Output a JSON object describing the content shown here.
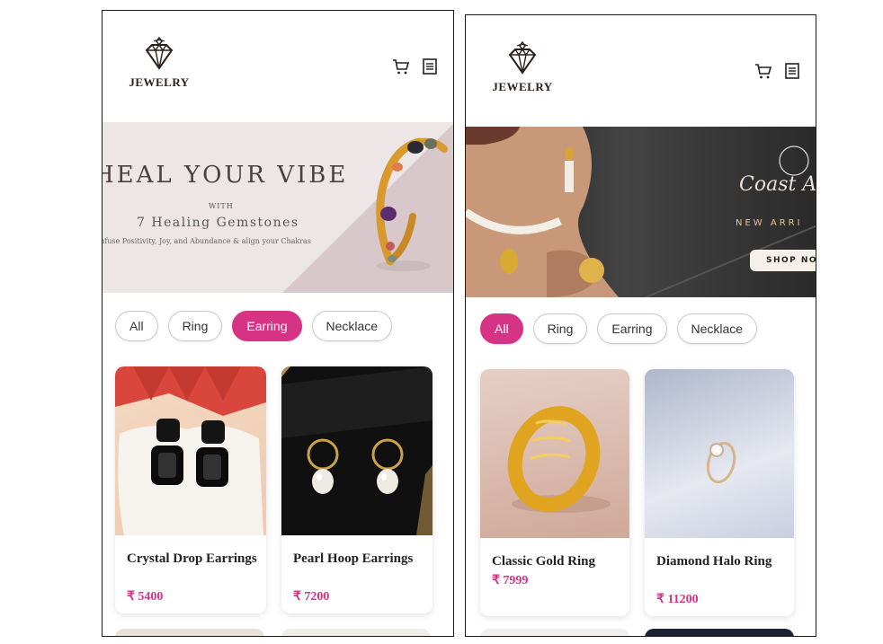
{
  "screens": [
    {
      "header": {
        "logo_text": "JEWELRY",
        "cart_icon": "cart-icon",
        "menu_icon": "menu-icon"
      },
      "banner": {
        "title": "HEAL YOUR VIBE",
        "with": "WITH",
        "subtitle": "7 Healing Gemstones",
        "tagline": "Infuse Positivity, Joy, and Abundance & align your Chakras"
      },
      "filters": [
        {
          "label": "All",
          "active": false
        },
        {
          "label": "Ring",
          "active": false
        },
        {
          "label": "Earring",
          "active": true
        },
        {
          "label": "Necklace",
          "active": false
        }
      ],
      "products": [
        {
          "name": "Crystal Drop Earrings",
          "price": "₹ 5400"
        },
        {
          "name": "Pearl Hoop Earrings",
          "price": "₹ 7200"
        }
      ]
    },
    {
      "header": {
        "logo_text": "JEWELRY",
        "cart_icon": "cart-icon",
        "menu_icon": "menu-icon"
      },
      "banner": {
        "script_title": "Coast A",
        "new_arrivals": "NEW ARRI",
        "shop_button": "SHOP NO"
      },
      "filters": [
        {
          "label": "All",
          "active": true
        },
        {
          "label": "Ring",
          "active": false
        },
        {
          "label": "Earring",
          "active": false
        },
        {
          "label": "Necklace",
          "active": false
        }
      ],
      "products": [
        {
          "name": "Classic Gold Ring",
          "price": "₹ 7999"
        },
        {
          "name": "Diamond Halo Ring",
          "price": "₹ 11200"
        }
      ]
    }
  ],
  "colors": {
    "accent": "#d63384",
    "logo": "#2b2118"
  }
}
